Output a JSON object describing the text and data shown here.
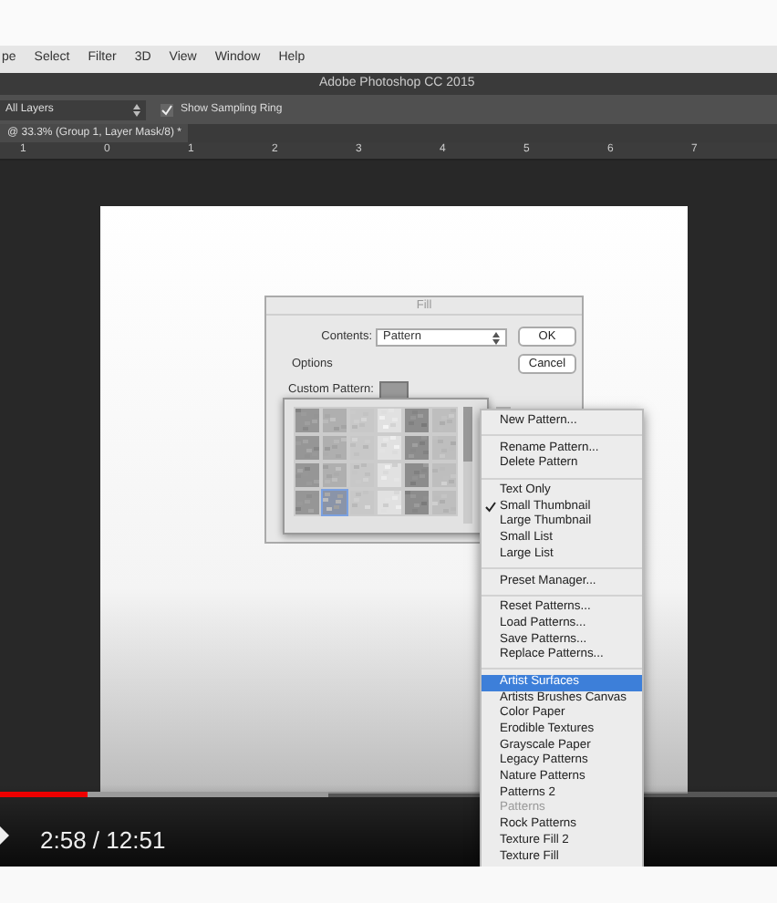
{
  "app_menu": [
    "pe",
    "Select",
    "Filter",
    "3D",
    "View",
    "Window",
    "Help"
  ],
  "window": {
    "title": "Adobe Photoshop CC 2015"
  },
  "options_bar": {
    "sample": {
      "value": "All Layers"
    },
    "sampling_ring": {
      "label": "Show Sampling Ring",
      "checked": true
    }
  },
  "document_tab": {
    "label": "@ 33.3% (Group 1, Layer Mask/8) *"
  },
  "ruler": {
    "labels": [
      "1",
      "0",
      "1",
      "2",
      "3",
      "4",
      "5",
      "6",
      "7"
    ]
  },
  "fill_dialog": {
    "title": "Fill",
    "contents_label": "Contents:",
    "contents_value": "Pattern",
    "buttons": [
      "OK",
      "Cancel"
    ],
    "options_label": "Options",
    "custom_pattern_label": "Custom Pattern:",
    "patterns": [
      {
        "selected": false
      },
      {
        "selected": false
      },
      {
        "selected": false
      },
      {
        "selected": false
      },
      {
        "selected": false
      },
      {
        "selected": false
      },
      {
        "selected": false
      },
      {
        "selected": false
      },
      {
        "selected": false
      },
      {
        "selected": false
      },
      {
        "selected": false
      },
      {
        "selected": false
      },
      {
        "selected": false
      },
      {
        "selected": false
      },
      {
        "selected": false
      },
      {
        "selected": false
      },
      {
        "selected": false
      },
      {
        "selected": false
      },
      {
        "selected": false
      },
      {
        "selected": true
      },
      {
        "selected": false
      },
      {
        "selected": false
      },
      {
        "selected": false
      },
      {
        "selected": false
      }
    ]
  },
  "pattern_menu": {
    "groups": [
      [
        {
          "label": "New Pattern..."
        }
      ],
      [
        {
          "label": "Rename Pattern..."
        },
        {
          "label": "Delete Pattern"
        }
      ],
      [
        {
          "label": "Text Only",
          "checked": false
        },
        {
          "label": "Small Thumbnail",
          "checked": true
        },
        {
          "label": "Large Thumbnail",
          "checked": false
        },
        {
          "label": "Small List",
          "checked": false
        },
        {
          "label": "Large List",
          "checked": false
        }
      ],
      [
        {
          "label": "Preset Manager..."
        }
      ],
      [
        {
          "label": "Reset Patterns..."
        },
        {
          "label": "Load Patterns..."
        },
        {
          "label": "Save Patterns..."
        },
        {
          "label": "Replace Patterns..."
        }
      ],
      [
        {
          "label": "Artist Surfaces",
          "selected": true,
          "disabled": false
        },
        {
          "label": "Artists Brushes Canvas",
          "selected": false,
          "disabled": false
        },
        {
          "label": "Color Paper",
          "selected": false,
          "disabled": false
        },
        {
          "label": "Erodible Textures",
          "selected": false,
          "disabled": false
        },
        {
          "label": "Grayscale Paper",
          "selected": false,
          "disabled": false
        },
        {
          "label": "Legacy Patterns",
          "selected": false,
          "disabled": false
        },
        {
          "label": "Nature Patterns",
          "selected": false,
          "disabled": false
        },
        {
          "label": "Patterns 2",
          "selected": false,
          "disabled": false
        },
        {
          "label": "Patterns",
          "selected": false,
          "disabled": true
        },
        {
          "label": "Rock Patterns",
          "selected": false,
          "disabled": false
        },
        {
          "label": "Texture Fill 2",
          "selected": false,
          "disabled": false
        },
        {
          "label": "Texture Fill",
          "selected": false,
          "disabled": false
        }
      ]
    ]
  },
  "video": {
    "progress": {
      "level": 0.113
    },
    "buffer": {
      "level": 0.423
    },
    "time": "2:58 / 12:51"
  }
}
